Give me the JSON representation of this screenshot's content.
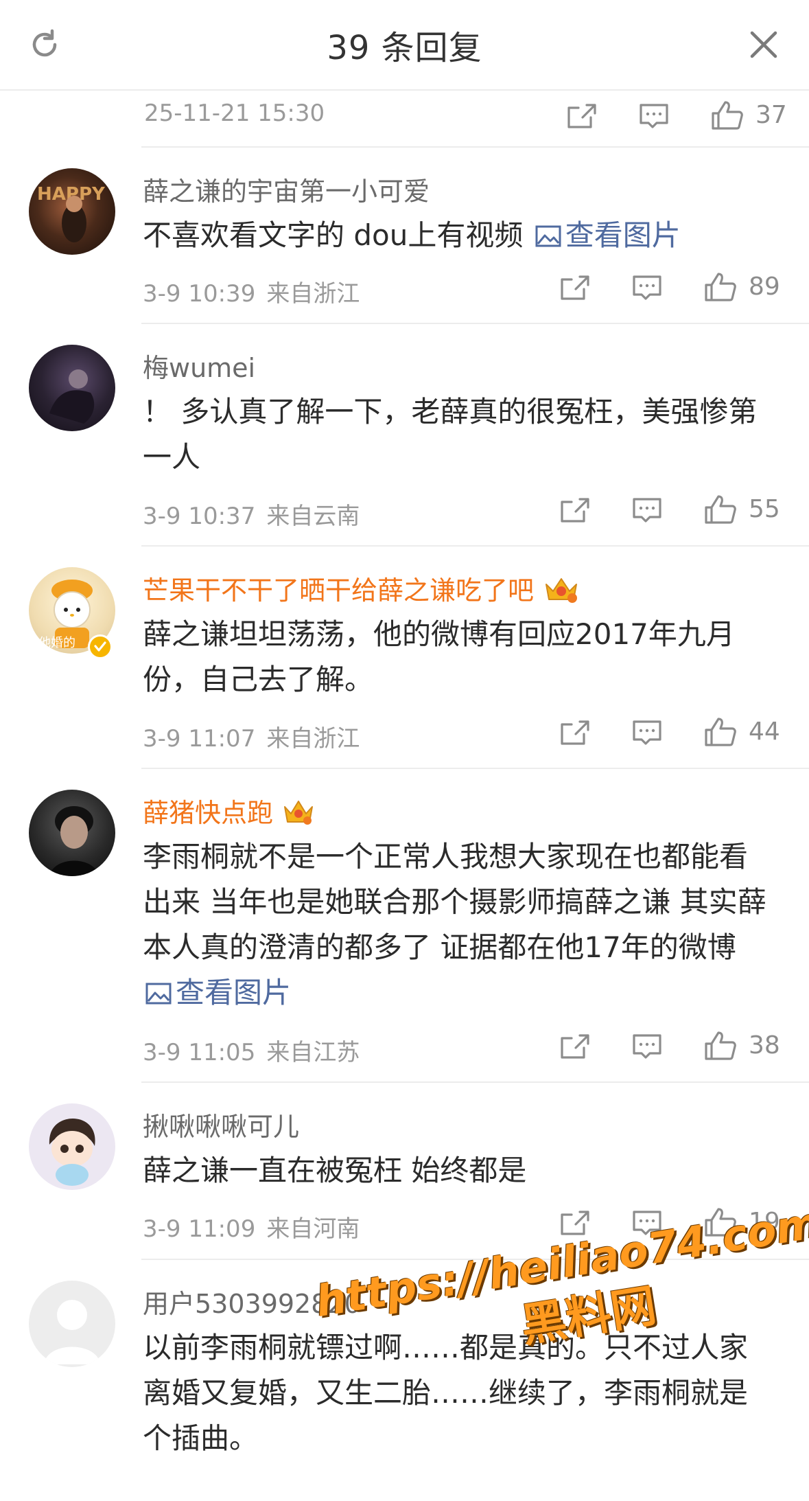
{
  "header": {
    "title": "39 条回复"
  },
  "top_meta": {
    "time": "25-11-21 15:30",
    "likes": "37"
  },
  "comments": [
    {
      "name": "薛之谦的宇宙第一小可爱",
      "text": "不喜欢看文字的 dou上有视频 ",
      "link": "查看图片",
      "time": "3-9 10:39",
      "location": "来自浙江",
      "likes": "89"
    },
    {
      "name": "梅wumei",
      "text": "！ 多认真了解一下，老薛真的很冤枉，美强惨第一人",
      "time": "3-9 10:37",
      "location": "来自云南",
      "likes": "55"
    },
    {
      "name": "芒果干不干了晒干给薛之谦吃了吧",
      "avatar_text": "他婚的",
      "text": "薛之谦坦坦荡荡，他的微博有回应2017年九月份，自己去了解。",
      "time": "3-9 11:07",
      "location": "来自浙江",
      "likes": "44"
    },
    {
      "name": "薛猪快点跑",
      "text": "李雨桐就不是一个正常人我想大家现在也都能看出来 当年也是她联合那个摄影师搞薛之谦 其实薛本人真的澄清的都多了 证据都在他17年的微博 ",
      "link": "查看图片",
      "time": "3-9 11:05",
      "location": "来自江苏",
      "likes": "38"
    },
    {
      "name": "揪啾啾啾可儿",
      "text": "薛之谦一直在被冤枉 始终都是",
      "time": "3-9 11:09",
      "location": "来自河南",
      "likes": "19"
    },
    {
      "name": "用户5303992820",
      "text": "以前李雨桐就镖过啊……都是真的。只不过人家离婚又复婚，又生二胎……继续了，李雨桐就是个插曲。"
    }
  ],
  "watermark": {
    "url": "https://heiliao74.com",
    "label": "黑料网"
  },
  "colors": {
    "vip_name": "#f2751a",
    "link": "#4f6a9f",
    "meta": "#9a9a9a"
  }
}
